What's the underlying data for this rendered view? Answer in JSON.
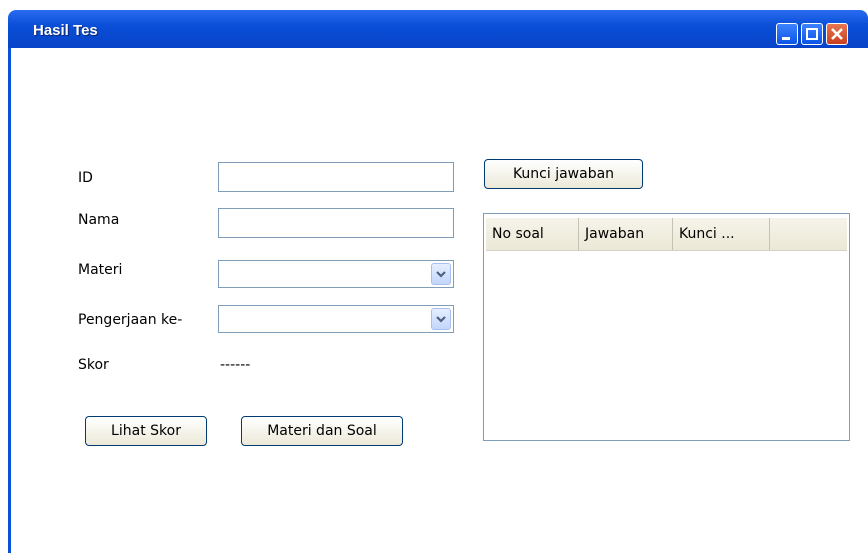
{
  "window": {
    "title": "Hasil Tes"
  },
  "form": {
    "id_label": "ID",
    "id_value": "",
    "nama_label": "Nama",
    "nama_value": "",
    "materi_label": "Materi",
    "materi_value": "",
    "pengerjaan_label": "Pengerjaan ke-",
    "pengerjaan_value": "",
    "skor_label": "Skor",
    "skor_value": "------"
  },
  "buttons": {
    "lihat_skor": "Lihat Skor",
    "materi_soal": "Materi dan Soal",
    "kunci_jawaban": "Kunci jawaban"
  },
  "table": {
    "columns": [
      "No soal",
      "Jawaban",
      "Kunci ..."
    ],
    "rows": []
  }
}
